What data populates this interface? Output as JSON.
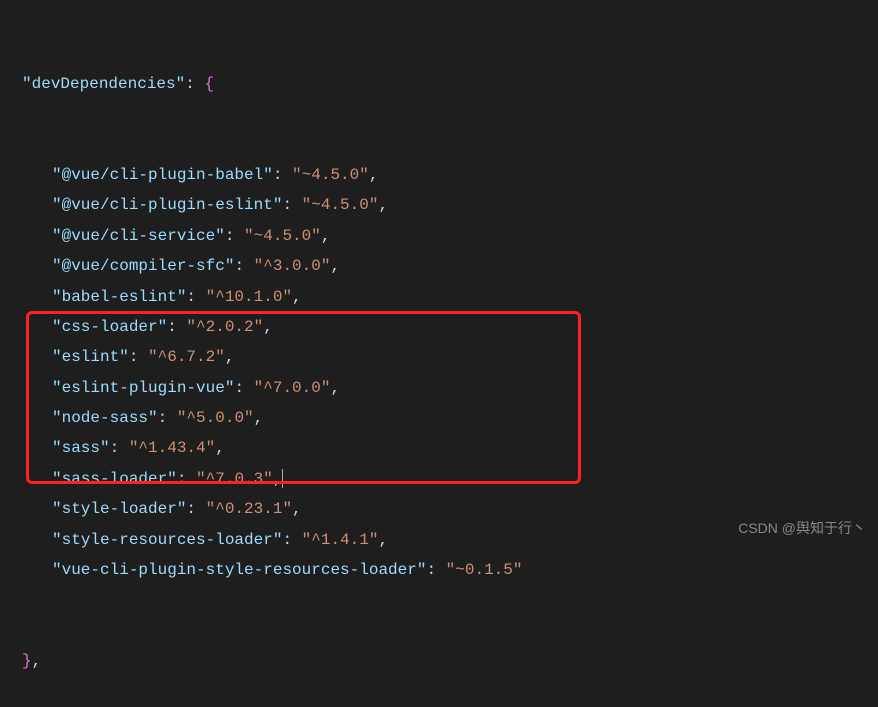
{
  "code": {
    "section_key": "devDependencies",
    "entries": [
      {
        "key": "@vue/cli-plugin-babel",
        "value": "~4.5.0",
        "comma": true
      },
      {
        "key": "@vue/cli-plugin-eslint",
        "value": "~4.5.0",
        "comma": true
      },
      {
        "key": "@vue/cli-service",
        "value": "~4.5.0",
        "comma": true
      },
      {
        "key": "@vue/compiler-sfc",
        "value": "^3.0.0",
        "comma": true
      },
      {
        "key": "babel-eslint",
        "value": "^10.1.0",
        "comma": true
      },
      {
        "key": "css-loader",
        "value": "^2.0.2",
        "comma": true
      },
      {
        "key": "eslint",
        "value": "^6.7.2",
        "comma": true
      },
      {
        "key": "eslint-plugin-vue",
        "value": "^7.0.0",
        "comma": true
      },
      {
        "key": "node-sass",
        "value": "^5.0.0",
        "comma": true
      },
      {
        "key": "sass",
        "value": "^1.43.4",
        "comma": true
      },
      {
        "key": "sass-loader",
        "value": "^7.0.3",
        "comma": true,
        "cursor": true
      },
      {
        "key": "style-loader",
        "value": "^0.23.1",
        "comma": true
      },
      {
        "key": "style-resources-loader",
        "value": "^1.4.1",
        "comma": true
      },
      {
        "key": "vue-cli-plugin-style-resources-loader",
        "value": "~0.1.5",
        "comma": false
      }
    ]
  },
  "watermark": "CSDN @舆知于行丶"
}
